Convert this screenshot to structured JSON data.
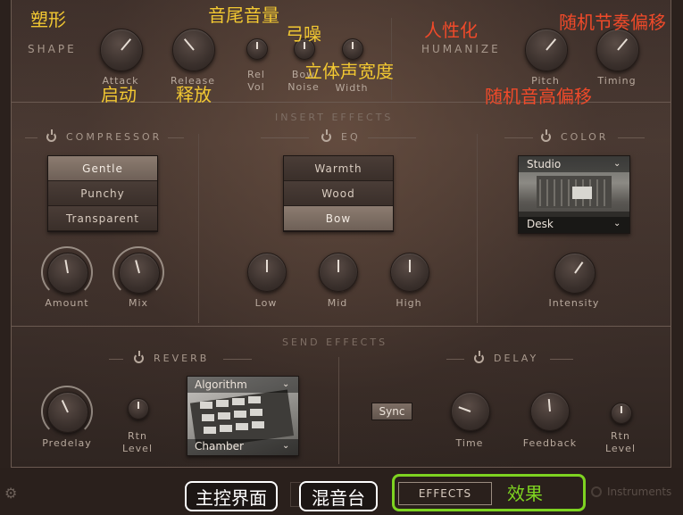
{
  "shape": {
    "label": "SHAPE",
    "annotation": "塑形",
    "knobs": [
      {
        "label": "Attack",
        "annotation": "启动"
      },
      {
        "label": "Release",
        "annotation": "释放"
      }
    ],
    "small_knobs": [
      {
        "label": "Rel\nVol",
        "annotation": "音尾音量"
      },
      {
        "label": "Bow\nNoise",
        "annotation": "弓噪"
      },
      {
        "label": "Width",
        "annotation": "立体声宽度"
      }
    ]
  },
  "humanize": {
    "label": "HUMANIZE",
    "annotation": "人性化",
    "knobs": [
      {
        "label": "Pitch",
        "annotation": "随机音高偏移"
      },
      {
        "label": "Timing",
        "annotation": "随机节奏偏移"
      }
    ]
  },
  "insert_effects": {
    "label": "INSERT EFFECTS",
    "compressor": {
      "label": "COMPRESSOR",
      "options": [
        "Gentle",
        "Punchy",
        "Transparent"
      ],
      "selected": "Gentle",
      "knobs": [
        "Amount",
        "Mix"
      ]
    },
    "eq": {
      "label": "EQ",
      "options": [
        "Warmth",
        "Wood",
        "Bow"
      ],
      "selected": "Bow",
      "knobs": [
        "Low",
        "Mid",
        "High"
      ]
    },
    "color": {
      "label": "COLOR",
      "preset_top": "Studio",
      "preset_bottom": "Desk",
      "knob": "Intensity"
    }
  },
  "send_effects": {
    "label": "SEND EFFECTS",
    "reverb": {
      "label": "REVERB",
      "knobs": [
        "Predelay",
        "Rtn\nLevel"
      ],
      "preset_top": "Algorithm",
      "preset_bottom": "Chamber"
    },
    "delay": {
      "label": "DELAY",
      "sync_label": "Sync",
      "knobs": [
        "Time",
        "Feedback",
        "Rtn\nLevel"
      ]
    }
  },
  "bottom": {
    "main_annotation": "主控界面",
    "mixer_annotation": "混音台",
    "effects_button": "EFFECTS",
    "effects_annotation": "效果",
    "instruments_label": "Instruments"
  },
  "colors": {
    "annotation_yellow": "#f2c832",
    "annotation_red": "#f04a2a",
    "highlight_green": "#7ed321"
  }
}
